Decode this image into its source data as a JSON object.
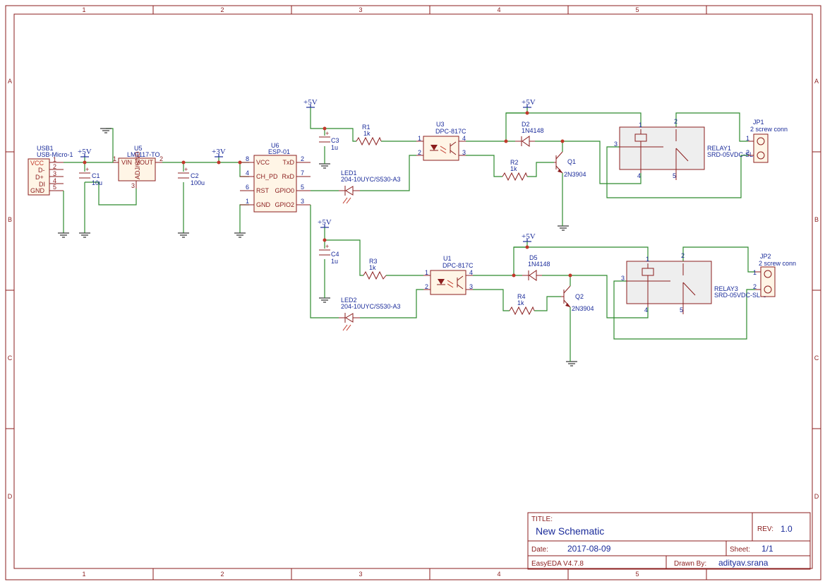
{
  "frame": {
    "columns": [
      "1",
      "2",
      "3",
      "4",
      "5"
    ],
    "rows": [
      "A",
      "B",
      "C",
      "D"
    ]
  },
  "title_block": {
    "title_label": "TITLE:",
    "title": "New Schematic",
    "rev_label": "REV:",
    "rev": "1.0",
    "date_label": "Date:",
    "date": "2017-08-09",
    "sheet_label": "Sheet:",
    "sheet": "1/1",
    "tool": "EasyEDA V4.7.8",
    "drawn_label": "Drawn By:",
    "drawn_by": "adityav.srana"
  },
  "power": {
    "p5v": "+5V",
    "p3v": "+3V"
  },
  "components": {
    "usb1": {
      "ref": "USB1",
      "value": "USB-Micro-1",
      "pins": [
        "VCC",
        "D-",
        "D+",
        "DI",
        "GND"
      ],
      "pin_nums": [
        "1",
        "2",
        "3",
        "4",
        "5"
      ]
    },
    "c1": {
      "ref": "C1",
      "value": "10u"
    },
    "u5": {
      "ref": "U5",
      "value": "LM1117-TO",
      "vin": "VIN",
      "vout": "VOUT",
      "adj": "ADJ/GND",
      "p1": "1",
      "p2": "2",
      "p3": "3"
    },
    "c2": {
      "ref": "C2",
      "value": "100u"
    },
    "u6": {
      "ref": "U6",
      "value": "ESP-01",
      "left_pins": [
        "VCC",
        "CH_PD",
        "RST",
        "GND"
      ],
      "left_nums": [
        "8",
        "4",
        "6",
        "1"
      ],
      "right_pins": [
        "TxD",
        "RxD",
        "GPIO0",
        "GPIO2"
      ],
      "right_nums": [
        "2",
        "7",
        "5",
        "3"
      ]
    },
    "c3": {
      "ref": "C3",
      "value": "1u"
    },
    "c4": {
      "ref": "C4",
      "value": "1u"
    },
    "r1": {
      "ref": "R1",
      "value": "1k"
    },
    "r2": {
      "ref": "R2",
      "value": "1k"
    },
    "r3": {
      "ref": "R3",
      "value": "1k"
    },
    "r4": {
      "ref": "R4",
      "value": "1k"
    },
    "led1": {
      "ref": "LED1",
      "value": "204-10UYC/S530-A3"
    },
    "led2": {
      "ref": "LED2",
      "value": "204-10UYC/S530-A3"
    },
    "u3": {
      "ref": "U3",
      "value": "DPC-817C",
      "p1": "1",
      "p2": "2",
      "p3": "3",
      "p4": "4"
    },
    "u1": {
      "ref": "U1",
      "value": "DPC-817C",
      "p1": "1",
      "p2": "2",
      "p3": "3",
      "p4": "4"
    },
    "d2": {
      "ref": "D2",
      "value": "1N4148"
    },
    "d5": {
      "ref": "D5",
      "value": "1N4148"
    },
    "q1": {
      "ref": "Q1",
      "value": "2N3904"
    },
    "q2": {
      "ref": "Q2",
      "value": "2N3904"
    },
    "relay1": {
      "ref": "RELAY1",
      "value": "SRD-05VDC-SL-C",
      "p1": "1",
      "p2": "2",
      "p3": "3",
      "p4": "4",
      "p5": "5"
    },
    "relay3": {
      "ref": "RELAY3",
      "value": "SRD-05VDC-SL-C",
      "p1": "1",
      "p2": "2",
      "p3": "3",
      "p4": "4",
      "p5": "5"
    },
    "jp1": {
      "ref": "JP1",
      "value": "2 screw conn",
      "p1": "1",
      "p2": "2"
    },
    "jp2": {
      "ref": "JP2",
      "value": "2 screw conn",
      "p1": "1",
      "p2": "2"
    }
  },
  "colors": {
    "border": "#8b1e1e",
    "wire": "#2e8b2e",
    "text": "#1a2b9a",
    "junction": "#c0392b"
  }
}
